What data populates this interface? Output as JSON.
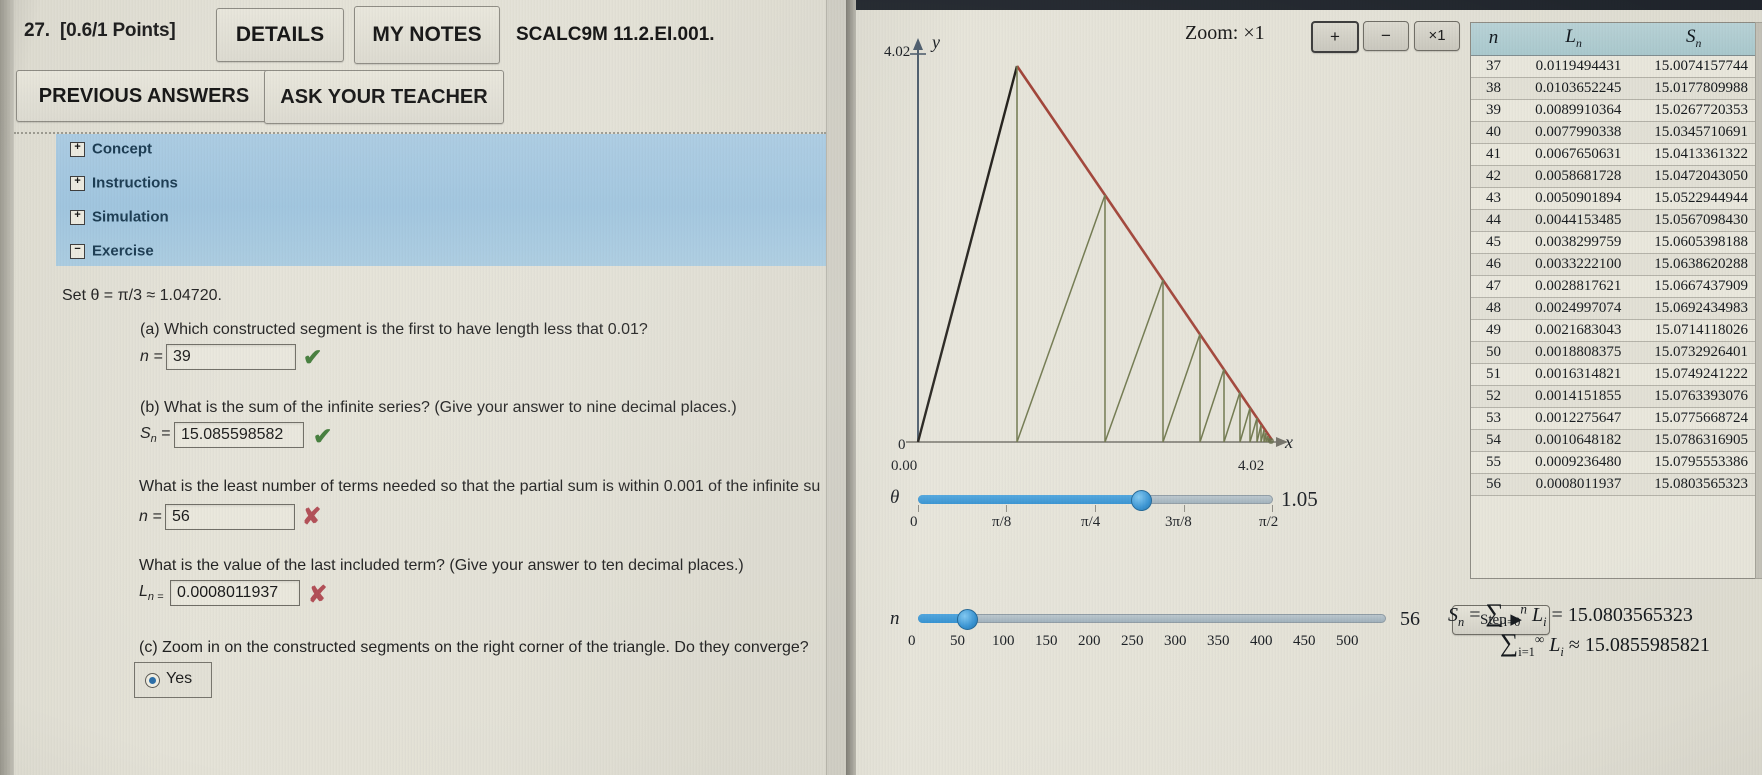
{
  "assignment": {
    "problem_number": "27.",
    "points": "[0.6/1 Points]",
    "details_button": "DETAILS",
    "my_notes_button": "MY NOTES",
    "problem_code": "SCALC9M 11.2.EI.001.",
    "previous_answers_button": "PREVIOUS ANSWERS",
    "ask_teacher_button": "ASK YOUR TEACHER"
  },
  "accordion": {
    "items": [
      {
        "label": "Concept",
        "toggle": "+"
      },
      {
        "label": "Instructions",
        "toggle": "+"
      },
      {
        "label": "Simulation",
        "toggle": "+"
      },
      {
        "label": "Exercise",
        "toggle": "−"
      }
    ]
  },
  "exercise": {
    "setup": "Set θ = π/3 ≈ 1.04720.",
    "part_a": {
      "prompt": "(a) Which constructed segment is the first to have length less that 0.01?",
      "label": "n =",
      "value": "39",
      "status": "correct",
      "mark": "✔"
    },
    "part_b": {
      "prompt": "(b) What is the sum of the infinite series? (Give your answer to nine decimal places.)",
      "label": "S",
      "label_sub": "n",
      "equals": "=",
      "value": "15.085598582",
      "status": "correct",
      "mark": "✔"
    },
    "part_b2": {
      "prompt": "What is the least number of terms needed so that the partial sum is within 0.001 of the infinite su",
      "label": "n =",
      "value": "56",
      "status": "incorrect",
      "mark": "✘"
    },
    "part_b3": {
      "prompt": "What is the value of the last included term? (Give your answer to ten decimal places.)",
      "label": "L",
      "label_sub": "n =",
      "value": "0.0008011937",
      "status": "incorrect",
      "mark": "✘"
    },
    "part_c": {
      "prompt": "(c) Zoom in on the constructed segments on the right corner of the triangle. Do they converge?",
      "option_yes": "Yes",
      "selected": "Yes"
    }
  },
  "simulation": {
    "zoom_label": "Zoom:",
    "zoom_value": "×1",
    "zoom_in_button": "+",
    "zoom_out_button": "−",
    "zoom_reset_button": "×1",
    "step_button": "Step ▶",
    "n_current": "56",
    "axis": {
      "y_label": "y",
      "x_label": "x",
      "y_max": "4.02",
      "y_origin": "0",
      "x_origin": "0.00",
      "x_max": "4.02"
    },
    "theta_slider": {
      "var": "θ",
      "value": "1.05",
      "ticks": [
        "0",
        "π/8",
        "π/4",
        "3π/8",
        "π/2"
      ],
      "fill_percent": 66
    },
    "n_slider": {
      "var": "n",
      "value": "56",
      "ticks": [
        "0",
        "50",
        "100",
        "150",
        "200",
        "250",
        "300",
        "350",
        "400",
        "450",
        "500"
      ],
      "fill_percent": 12
    },
    "formula_partial": "S n = ∑ i=0 n L i = 15.0803565323",
    "formula_partial_value": "15.0803565323",
    "formula_infinite": "∑ i=1 ∞ L i ≈ 15.0855985821",
    "formula_infinite_value": "15.0855985821"
  },
  "table": {
    "headers": [
      "n",
      "L",
      "S"
    ],
    "header_subs": [
      "",
      "n",
      "n"
    ],
    "rows": [
      {
        "n": "37",
        "L": "0.0119494431",
        "S": "15.0074157744"
      },
      {
        "n": "38",
        "L": "0.0103652245",
        "S": "15.0177809988"
      },
      {
        "n": "39",
        "L": "0.0089910364",
        "S": "15.0267720353"
      },
      {
        "n": "40",
        "L": "0.0077990338",
        "S": "15.0345710691"
      },
      {
        "n": "41",
        "L": "0.0067650631",
        "S": "15.0413361322"
      },
      {
        "n": "42",
        "L": "0.0058681728",
        "S": "15.0472043050"
      },
      {
        "n": "43",
        "L": "0.0050901894",
        "S": "15.0522944944"
      },
      {
        "n": "44",
        "L": "0.0044153485",
        "S": "15.0567098430"
      },
      {
        "n": "45",
        "L": "0.0038299759",
        "S": "15.0605398188"
      },
      {
        "n": "46",
        "L": "0.0033222100",
        "S": "15.0638620288"
      },
      {
        "n": "47",
        "L": "0.0028817621",
        "S": "15.0667437909"
      },
      {
        "n": "48",
        "L": "0.0024997074",
        "S": "15.0692434983"
      },
      {
        "n": "49",
        "L": "0.0021683043",
        "S": "15.0714118026"
      },
      {
        "n": "50",
        "L": "0.0018808375",
        "S": "15.0732926401"
      },
      {
        "n": "51",
        "L": "0.0016314821",
        "S": "15.0749241222"
      },
      {
        "n": "52",
        "L": "0.0014151855",
        "S": "15.0763393076"
      },
      {
        "n": "53",
        "L": "0.0012275647",
        "S": "15.0775668724"
      },
      {
        "n": "54",
        "L": "0.0010648182",
        "S": "15.0786316905"
      },
      {
        "n": "55",
        "L": "0.0009236480",
        "S": "15.0795553386"
      },
      {
        "n": "56",
        "L": "0.0008011937",
        "S": "15.0803565323"
      }
    ]
  },
  "chart_data": {
    "type": "line",
    "title": "",
    "xlabel": "x",
    "ylabel": "y",
    "xlim": [
      0,
      4.02
    ],
    "ylim": [
      0,
      4.02
    ],
    "description": "Spiral-of-segments construction inside a triangle; hypotenuse drawn in dark red from apex down to the right corner, left leg dark, and a sequence of converging vertical/slanted constructed segments in olive-green.",
    "series": [
      {
        "name": "left-leg",
        "color": "#1d1a14",
        "points": [
          [
            0,
            0
          ],
          [
            1.34,
            3.4
          ]
        ]
      },
      {
        "name": "hypotenuse",
        "color": "#9e3d31",
        "points": [
          [
            1.34,
            3.4
          ],
          [
            4.02,
            0
          ]
        ]
      },
      {
        "name": "base",
        "color": "#6f6d64",
        "points": [
          [
            0,
            0
          ],
          [
            4.02,
            0
          ]
        ]
      }
    ],
    "constructed_segment_color": "#6f7a4a",
    "grid": false,
    "legend": "none"
  },
  "scrollbar": {
    "up_arrow": "▲"
  }
}
